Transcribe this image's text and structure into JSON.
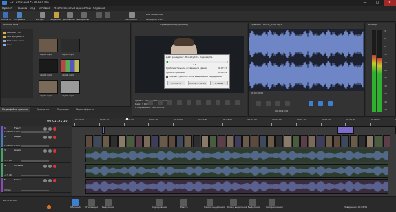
{
  "window": {
    "title": "Без названия * - VEGAS Pro",
    "controls": [
      "—",
      "□",
      "✕"
    ]
  },
  "menu": [
    "Проект",
    "Правка",
    "Вид",
    "Вставка",
    "Инструменты",
    "Параметры",
    "Справка"
  ],
  "toolbar": {
    "buttons": [
      "Открыть",
      "Сохранить",
      "Отменить",
      "Повторить",
      "Импорт",
      "Рендеринг",
      "Добавить трек",
      "Эффекты",
      "Настройки"
    ],
    "project_name": "Без названия",
    "render_label": "Рендеринг как..."
  },
  "explorer": {
    "path": "Рабочий стол",
    "tree": [
      "Рабочий стол",
      "Мои документы",
      "Мой компьютер",
      "Сеть"
    ],
    "thumbs": [
      "clip01.mp4",
      "clip02.mp4",
      "clip03.mp4",
      "clip04.mp4",
      "clip05.mp4",
      "clip06.mp4"
    ],
    "tabs": [
      "Медиафайлы проекта",
      "Проводник",
      "Переходы",
      "Видеоэффекты"
    ]
  },
  "preview": {
    "header": "Предпросмотр (полное)",
    "info_project": "Проект: 1920x1080x32; 29,970p",
    "info_frame": "Кадр: 3 900",
    "info_display": "Отображение: 316x178x32"
  },
  "dialog": {
    "title": "Идёт рендеринг. Пожалуйста, подождите.",
    "percent": "2 %",
    "progress": 0.02,
    "remaining_label": "Приблизительное оставшееся время:",
    "remaining_value": "00:07:27",
    "elapsed_label": "Прошло времени:",
    "elapsed_value": "00:00:09",
    "checkbox_label": "Закрыть диалог после завершения рендеринга",
    "btn_open": "Открыть",
    "btn_folder": "Открыть папку",
    "btn_cancel": "Отмена"
  },
  "trimmer": {
    "header": "Триммер - musik_track.mp3",
    "time_start": "00:00:00;00",
    "time_cursor": "00:04:23;00"
  },
  "meters": {
    "header": "Мастер",
    "scale": [
      "-3",
      "-6",
      "-9",
      "-12",
      "-18",
      "-24",
      "-30",
      "-36",
      "-42",
      "-48",
      "-54"
    ]
  },
  "timeline": {
    "timecode": "00:02:51;28",
    "ruler": [
      "00:00:00",
      "00:00:30",
      "00:01:00",
      "00:01:30",
      "00:02:00",
      "00:02:30",
      "00:03:00",
      "00:03:30",
      "00:04:00",
      "00:04:30",
      "00:05:00",
      "00:05:30",
      "00:06:00",
      "00:06:30"
    ],
    "tracks": [
      {
        "num": "1",
        "name": "Текст",
        "level": "Уровень: 100,0 %"
      },
      {
        "num": "2",
        "name": "Видео",
        "level": "Уровень: 100,0 %"
      },
      {
        "num": "3",
        "name": "Аудио",
        "level": "-0,1 дБ"
      },
      {
        "num": "4",
        "name": "Музыка",
        "level": "-2,5 дБ"
      },
      {
        "num": "5",
        "name": "Голос",
        "level": "0,0 дБ"
      }
    ]
  },
  "bottombar": {
    "rate": "Частота: 0,00",
    "buttons": [
      "Обычный",
      "Огибающая",
      "Выделение",
      "Резать",
      "Кадрирование",
      "Начало выделения",
      "Конец выделения",
      "Выделение",
      "Синхронизация"
    ],
    "status": "Завершено: 00:02:51"
  },
  "colors": {
    "accent": "#3d7fd0",
    "waveform": "#6f86c6",
    "timeline_bg": "#3a3a3a",
    "record": "#d33"
  }
}
